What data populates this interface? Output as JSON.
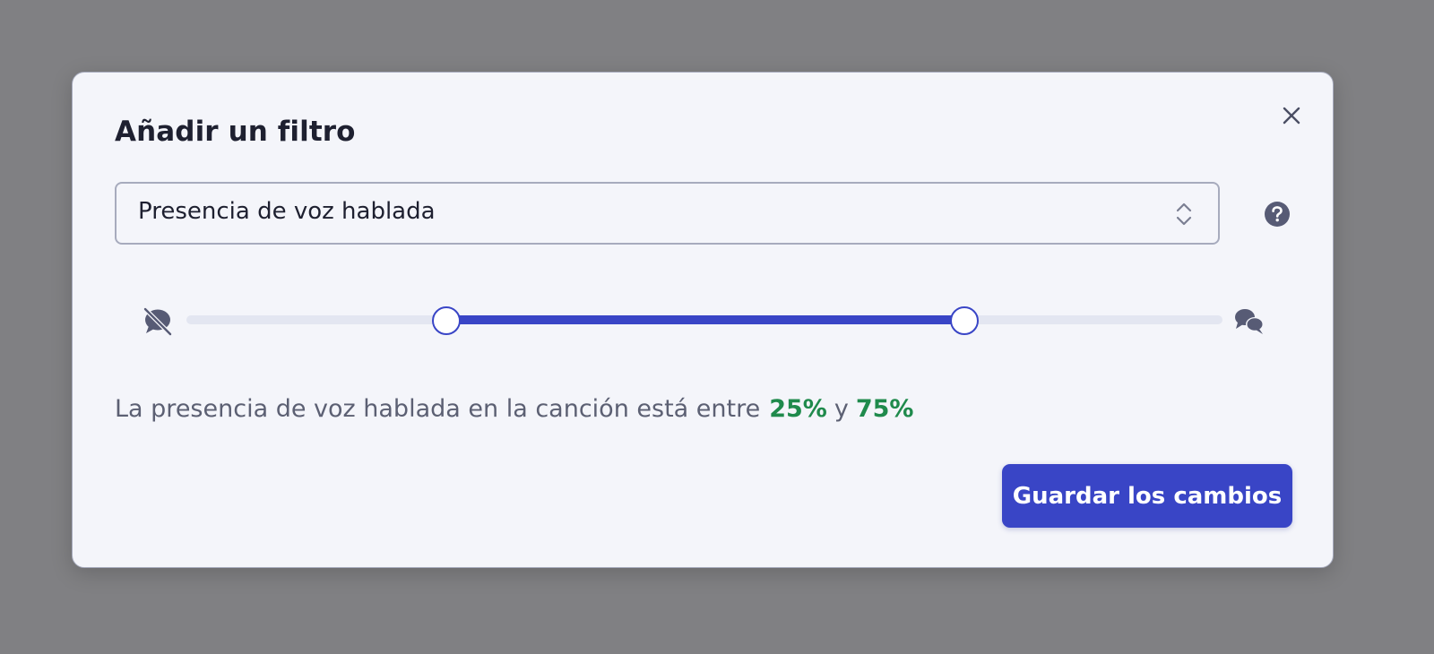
{
  "modal": {
    "title": "Añadir un filtro",
    "close_icon": "close-icon"
  },
  "filter_select": {
    "value": "Presencia de voz hablada",
    "chevron_icon": "up-down-chevron-icon"
  },
  "help": {
    "icon": "question-circle-icon"
  },
  "range_slider": {
    "min_icon": "speech-off-icon",
    "max_icon": "speech-bubbles-icon",
    "low": 0.25,
    "high": 0.75,
    "accent_color": "#3945c6",
    "track_color": "#e3e6f1"
  },
  "summary": {
    "lead": "La presencia de voz hablada en la canción está entre",
    "low_text": "25%",
    "conj": "y",
    "high_text": "75%",
    "value_color": "#1f8a4c"
  },
  "actions": {
    "save_label": "Guardar los cambios"
  }
}
